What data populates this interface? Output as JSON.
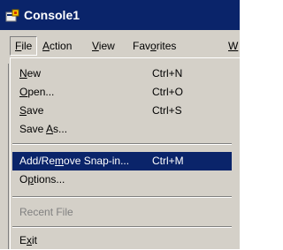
{
  "window": {
    "title": "Console1",
    "icon": "mmc-console-icon"
  },
  "menubar": {
    "items": [
      {
        "label": "File",
        "mnemonic_index": 0
      },
      {
        "label": "Action",
        "mnemonic_index": 0
      },
      {
        "label": "View",
        "mnemonic_index": 0
      },
      {
        "label": "Favorites",
        "mnemonic_index": 3
      },
      {
        "label": "W",
        "mnemonic_index": 0
      }
    ]
  },
  "file_menu": {
    "items": [
      {
        "label_pre": "",
        "mn": "N",
        "label_post": "ew",
        "shortcut": "Ctrl+N"
      },
      {
        "label_pre": "",
        "mn": "O",
        "label_post": "pen...",
        "shortcut": "Ctrl+O"
      },
      {
        "label_pre": "",
        "mn": "S",
        "label_post": "ave",
        "shortcut": "Ctrl+S"
      },
      {
        "label_pre": "Save ",
        "mn": "A",
        "label_post": "s...",
        "shortcut": ""
      },
      {
        "label_pre": "Add/Re",
        "mn": "m",
        "label_post": "ove Snap-in...",
        "shortcut": "Ctrl+M"
      },
      {
        "label_pre": "O",
        "mn": "p",
        "label_post": "tions...",
        "shortcut": ""
      },
      {
        "label": "Recent File"
      },
      {
        "label_pre": "E",
        "mn": "x",
        "label_post": "it",
        "shortcut": ""
      }
    ],
    "highlighted_index": 4,
    "disabled_index": 6
  },
  "colors": {
    "titlebar": "#0a246a",
    "face": "#d4d0c8",
    "highlight": "#0a246a",
    "disabled_text": "#808080"
  }
}
